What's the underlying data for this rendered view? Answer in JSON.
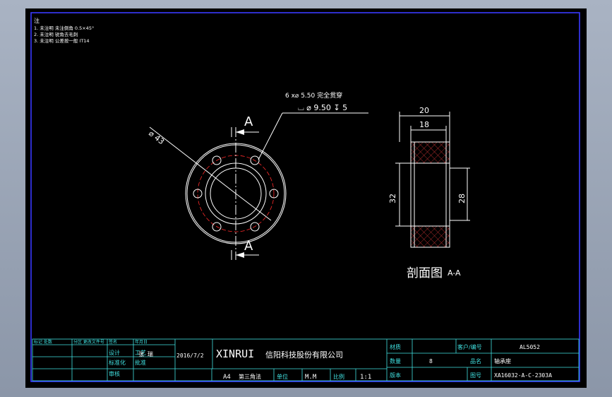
{
  "notes": {
    "heading": "注",
    "lines": [
      "1. 未注明 未注倒角 0.5×45°",
      "2. 未注明 锐角去毛刺",
      "3. 未注明 公差按一般 IT14"
    ]
  },
  "front_view": {
    "section_letter_top": "A",
    "section_letter_bottom": "A",
    "diameter_label": "⌀ 43",
    "hole_callout_line1": "6 x⌀ 5.50 完全贯穿",
    "hole_callout_line2": "⌴ ⌀ 9.50 ↧ 5"
  },
  "section_view": {
    "dim_top_outer": "20",
    "dim_top_inner": "18",
    "dim_left": "32",
    "dim_right": "28",
    "caption": "剖面图",
    "caption_suffix": "A-A"
  },
  "title_block": {
    "header_left": [
      "标记 处数",
      "分区 更改文件号",
      "签名",
      "年月日"
    ],
    "row_labels": [
      "设计",
      "标准化",
      "审核",
      "工艺",
      "批准"
    ],
    "designer": "张 瑞",
    "date": "2016/7/2",
    "company_en": "XINRUI",
    "company_cn": "信阳科技股份有限公司",
    "sheet_size": "A4",
    "projection": "第三角法",
    "unit_label": "单位",
    "unit_value": "M.M",
    "scale_label": "比例",
    "scale_value": "1:1",
    "material_label": "材质",
    "material_value": "",
    "quantity_label": "数量",
    "quantity_value": "8",
    "drawing_label": "图号",
    "drawing_value": "XA16032-A-C-2303A",
    "name_label": "品名",
    "name_value": "轴承座",
    "customer_label": "客户/编号",
    "customer_value": "AL5052",
    "version_label": "版本",
    "version_value": ""
  }
}
